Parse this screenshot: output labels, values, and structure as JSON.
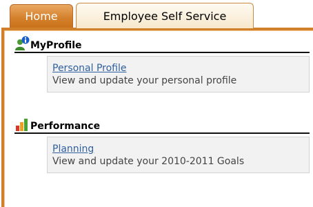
{
  "tabs": {
    "home": "Home",
    "ess": "Employee Self Service"
  },
  "sections": [
    {
      "title": "MyProfile",
      "icon": "user-info-icon",
      "link": "Personal Profile",
      "desc": "View and update your personal profile"
    },
    {
      "title": "Performance",
      "icon": "bar-chart-icon",
      "link": "Planning",
      "desc": "View and update your 2010-2011 Goals"
    }
  ],
  "colors": {
    "accent": "#d0802a",
    "link": "#2f5f9e"
  }
}
